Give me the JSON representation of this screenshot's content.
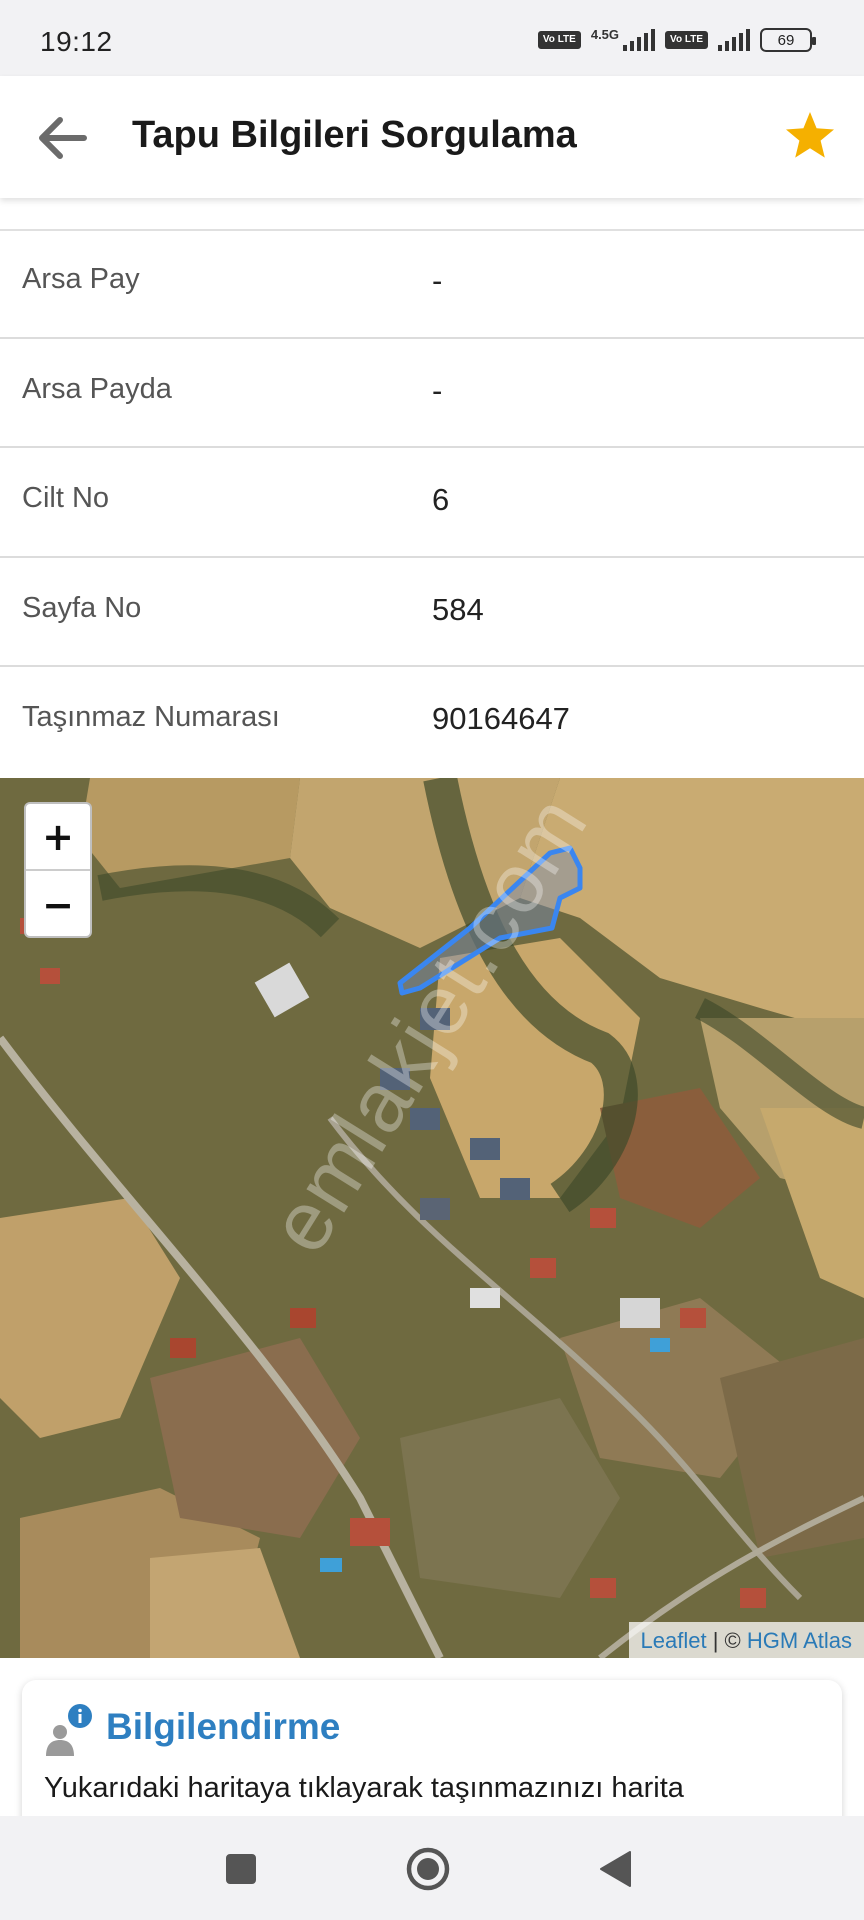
{
  "status_bar": {
    "time": "19:12",
    "network_label": "4.5G",
    "volte_1": "Vo LTE",
    "volte_2": "Vo LTE",
    "battery": "69"
  },
  "app_bar": {
    "title": "Tapu Bilgileri Sorgulama",
    "back_icon": "arrow-left-icon",
    "favorite_icon": "star-icon",
    "accent_color": "#f5b000"
  },
  "info_rows": [
    {
      "label": "Arsa Pay",
      "value": "-"
    },
    {
      "label": "Arsa Payda",
      "value": "-"
    },
    {
      "label": "Cilt No",
      "value": "6"
    },
    {
      "label": "Sayfa No",
      "value": "584"
    },
    {
      "label": "Taşınmaz Numarası",
      "value": "90164647"
    }
  ],
  "map": {
    "zoom_in": "+",
    "zoom_out": "−",
    "attribution_link_1": "Leaflet",
    "attribution_separator": " | © ",
    "attribution_link_2": "HGM Atlas",
    "parcel_outline_color": "#3a86f0",
    "watermark": "emlakjet.com"
  },
  "info_card": {
    "title": "Bilgilendirme",
    "text": "Yukarıdaki haritaya tıklayarak taşınmazınızı harita",
    "title_color": "#2e7fc1"
  },
  "nav_bar": {
    "recent_icon": "square-icon",
    "home_icon": "circle-icon",
    "back_icon": "triangle-back-icon"
  }
}
